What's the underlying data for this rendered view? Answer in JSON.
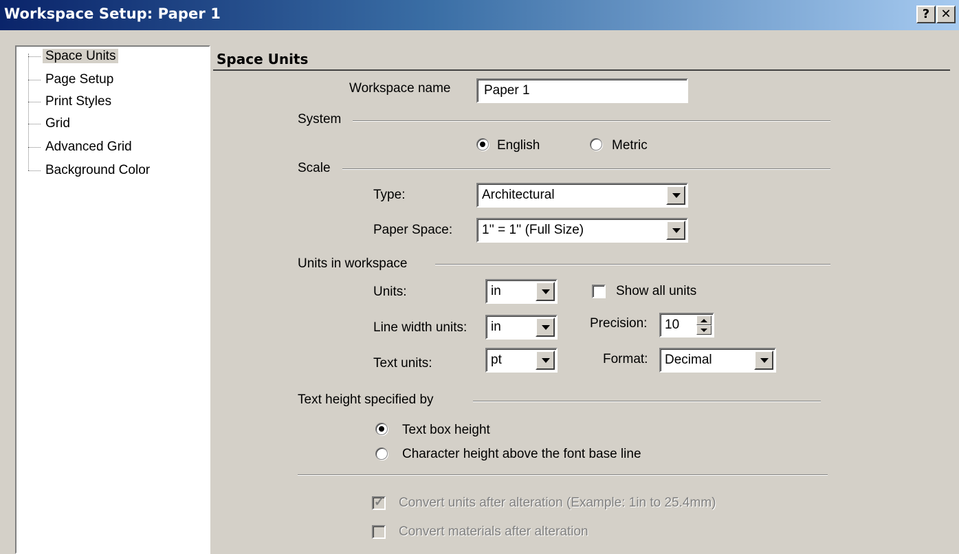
{
  "window": {
    "title": "Workspace Setup: Paper 1",
    "help_label": "?",
    "close_label": "✕"
  },
  "tree": {
    "items": [
      {
        "label": "Space Units",
        "selected": true
      },
      {
        "label": "Page Setup"
      },
      {
        "label": "Print Styles"
      },
      {
        "label": "Grid"
      },
      {
        "label": "Advanced Grid"
      },
      {
        "label": "Background Color"
      }
    ]
  },
  "panel": {
    "title": "Space Units",
    "workspace_name_label": "Workspace name",
    "workspace_name_value": "Paper 1",
    "system": {
      "group_label": "System",
      "english_label": "English",
      "metric_label": "Metric",
      "selected": "English"
    },
    "scale": {
      "group_label": "Scale",
      "type_label": "Type:",
      "type_value": "Architectural",
      "paper_space_label": "Paper Space:",
      "paper_space_value": "1'' = 1'' (Full Size)"
    },
    "units": {
      "group_label": "Units in workspace",
      "units_label": "Units:",
      "units_value": "in",
      "show_all_label": "Show all units",
      "show_all_checked": false,
      "line_width_label": "Line width units:",
      "line_width_value": "in",
      "precision_label": "Precision:",
      "precision_value": "10",
      "text_units_label": "Text units:",
      "text_units_value": "pt",
      "format_label": "Format:",
      "format_value": "Decimal"
    },
    "text_height": {
      "group_label": "Text height specified by",
      "option1": "Text box height",
      "option2": "Character height above the font base line",
      "selected": "Text box height"
    },
    "convert_units_label": "Convert units after alteration (Example: 1in to 25.4mm)",
    "convert_units_checked": true,
    "convert_materials_label": "Convert materials after alteration",
    "convert_materials_checked": false
  }
}
